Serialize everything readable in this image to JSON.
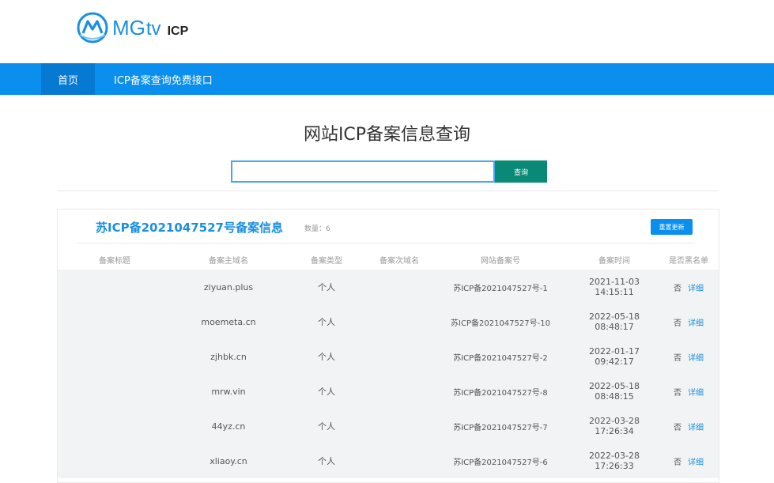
{
  "brand": {
    "mg": "MG",
    "tv": "tv",
    "icp": "ICP",
    "color": "#1a8fe0"
  },
  "nav": {
    "items": [
      {
        "label": "首页"
      },
      {
        "label": "ICP备案查询免费接口"
      }
    ],
    "color": "#0a8fef"
  },
  "search": {
    "title": "网站ICP备案信息查询",
    "value": "",
    "placeholder": "",
    "button_label": "查询"
  },
  "result": {
    "title": "苏ICP备2021047527号备案信息",
    "count": "数量：6",
    "refresh_label": "重置更新",
    "columns": [
      "备案标题",
      "备案主域名",
      "备案类型",
      "备案次域名",
      "网站备案号",
      "备案时间",
      "是否黑名单"
    ],
    "rows": [
      {
        "title": "",
        "domain": "ziyuan.plus",
        "type": "个人",
        "sub": "",
        "no": "苏ICP备2021047527号-1",
        "time": "2021-11-03 14:15:11",
        "black": "否",
        "detail": "详细"
      },
      {
        "title": "",
        "domain": "moemeta.cn",
        "type": "个人",
        "sub": "",
        "no": "苏ICP备2021047527号-10",
        "time": "2022-05-18 08:48:17",
        "black": "否",
        "detail": "详细"
      },
      {
        "title": "",
        "domain": "zjhbk.cn",
        "type": "个人",
        "sub": "",
        "no": "苏ICP备2021047527号-2",
        "time": "2022-01-17 09:42:17",
        "black": "否",
        "detail": "详细"
      },
      {
        "title": "",
        "domain": "mrw.vin",
        "type": "个人",
        "sub": "",
        "no": "苏ICP备2021047527号-8",
        "time": "2022-05-18 08:48:15",
        "black": "否",
        "detail": "详细"
      },
      {
        "title": "",
        "domain": "44yz.cn",
        "type": "个人",
        "sub": "",
        "no": "苏ICP备2021047527号-7",
        "time": "2022-03-28 17:26:34",
        "black": "否",
        "detail": "详细"
      },
      {
        "title": "",
        "domain": "xliaoy.cn",
        "type": "个人",
        "sub": "",
        "no": "苏ICP备2021047527号-6",
        "time": "2022-03-28 17:26:33",
        "black": "否",
        "detail": "详细"
      }
    ]
  }
}
